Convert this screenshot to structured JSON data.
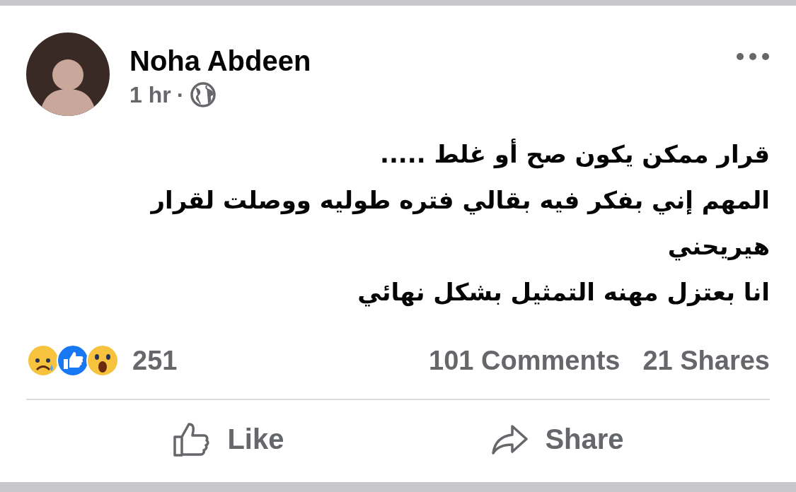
{
  "post": {
    "author": "Noha Abdeen",
    "time": "1 hr",
    "separator": "·",
    "body_lines": [
      "قرار ممكن يكون صح أو غلط .....",
      "المهم إني بفكر فيه بقالي فتره طوليه ووصلت لقرار",
      "هيريحني",
      "انا بعتزل مهنه التمثيل بشكل نهائي"
    ],
    "reactions": [
      {
        "kind": "sad"
      },
      {
        "kind": "like"
      },
      {
        "kind": "wow"
      }
    ],
    "reaction_count": "251",
    "comments": "101 Comments",
    "shares": "21 Shares",
    "like_button": "Like",
    "share_button": "Share"
  }
}
